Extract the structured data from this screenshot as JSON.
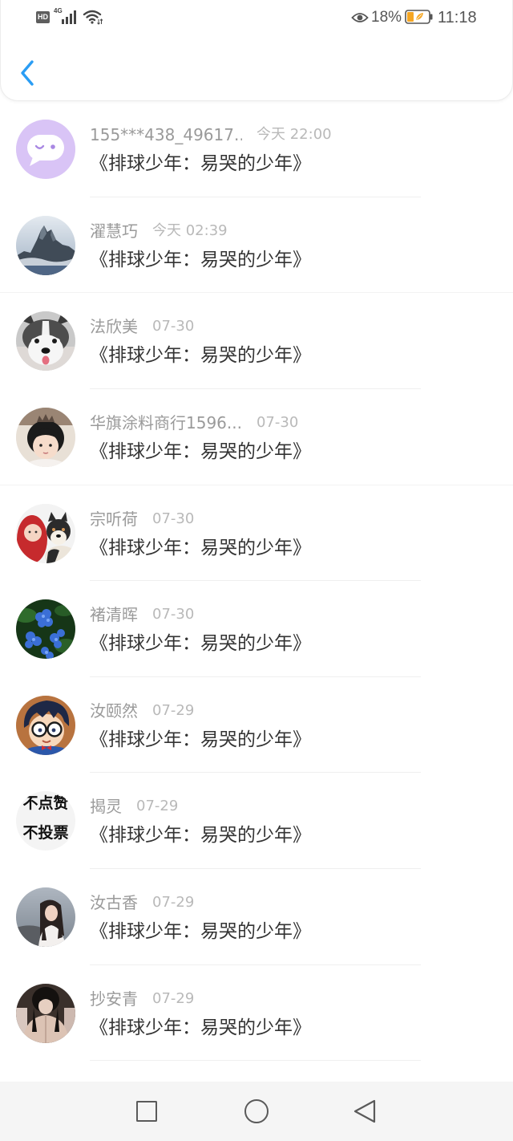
{
  "status_bar": {
    "hd_badge": "HD",
    "network_type": "4G",
    "battery_percent": "18%",
    "time": "11:18",
    "icons": [
      "signal-icon",
      "wifi-icon",
      "eye-icon",
      "battery-icon"
    ]
  },
  "header": {
    "back_icon": "chevron-left-icon"
  },
  "items": [
    {
      "name": "155***438_49617...",
      "time": "今天 22:00",
      "title": "《排球少年：易哭的少年》",
      "avatar": "chat-bubble-avatar"
    },
    {
      "name": "濯慧巧",
      "time": "今天 02:39",
      "title": "《排球少年：易哭的少年》",
      "avatar": "mountain-photo-avatar"
    },
    {
      "name": "法欣美",
      "time": "07-30",
      "title": "《排球少年：易哭的少年》",
      "avatar": "husky-photo-avatar"
    },
    {
      "name": "华旗涂料商行1596...",
      "time": "07-30",
      "title": "《排球少年：易哭的少年》",
      "avatar": "child-photo-avatar"
    },
    {
      "name": "宗听荷",
      "time": "07-30",
      "title": "《排球少年：易哭的少年》",
      "avatar": "baby-and-dog-photo-avatar"
    },
    {
      "name": "褚清晖",
      "time": "07-30",
      "title": "《排球少年：易哭的少年》",
      "avatar": "blue-flowers-photo-avatar"
    },
    {
      "name": "汝颐然",
      "time": "07-29",
      "title": "《排球少年：易哭的少年》",
      "avatar": "cartoon-boy-avatar"
    },
    {
      "name": "揭灵",
      "time": "07-29",
      "title": "《排球少年：易哭的少年》",
      "avatar": "text-avatar",
      "avatar_text": [
        "不点赞",
        "不投票"
      ]
    },
    {
      "name": "汝古香",
      "time": "07-29",
      "title": "《排球少年：易哭的少年》",
      "avatar": "girl-photo-avatar"
    },
    {
      "name": "抄安青",
      "time": "07-29",
      "title": "《排球少年：易哭的少年》",
      "avatar": "girl-coat-photo-avatar"
    }
  ],
  "nav_bar": {
    "icons": [
      "recent-apps-square-icon",
      "home-circle-icon",
      "back-triangle-icon"
    ]
  },
  "colors": {
    "accent": "#2a9df4",
    "name_text": "#9a9a9a",
    "time_text": "#b9b9b9",
    "title_text": "#333333",
    "battery_low": "#f5a623",
    "chat_avatar_bg": "#d9c4f6"
  }
}
